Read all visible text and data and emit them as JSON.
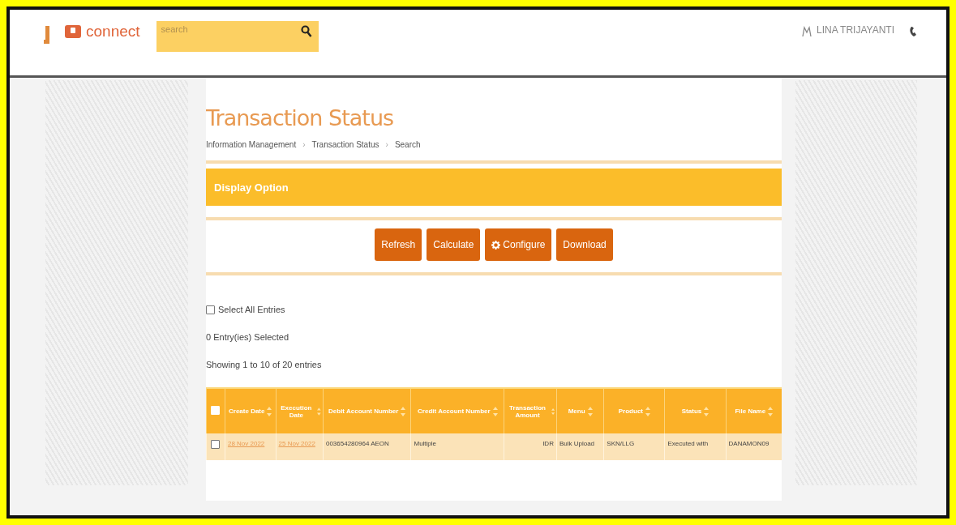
{
  "header": {
    "logo_text": "connect",
    "search": {
      "placeholder": "search"
    },
    "user": "LINA TRIJAYANTI"
  },
  "page": {
    "title": "Transaction Status",
    "breadcrumb_separator": "›",
    "breadcrumb": [
      "Information Management",
      "Transaction Status",
      "Search"
    ]
  },
  "display_option": {
    "title": "Display Option"
  },
  "buttons": [
    {
      "label": "Refresh",
      "kind": "plain"
    },
    {
      "label": "Calculate",
      "kind": "plain"
    },
    {
      "label": "Configure",
      "kind": "gear"
    },
    {
      "label": "Download",
      "kind": "plain"
    }
  ],
  "select_all": {
    "label": "Select All Entries",
    "checked": false
  },
  "selected_count": "0 Entry(ies) Selected",
  "showing": "Showing 1 to 10 of 20 entries",
  "table": {
    "header_checked": false,
    "columns": [
      {
        "label": "Create Date"
      },
      {
        "label": "Execution Date"
      },
      {
        "label": "Debit Account Number"
      },
      {
        "label": "Credit Account Number"
      },
      {
        "label": "Transaction Amount"
      },
      {
        "label": "Menu"
      },
      {
        "label": "Product"
      },
      {
        "label": "Status"
      },
      {
        "label": "File Name"
      }
    ],
    "rows": [
      {
        "checked": false,
        "cells": [
          {
            "text": "28 Nov 2022",
            "kind": "link"
          },
          {
            "text": "25 Nov 2022",
            "kind": "link"
          },
          {
            "text": "003654280964 AEON",
            "kind": "text"
          },
          {
            "text": "Multiple",
            "kind": "text"
          },
          {
            "text": "IDR",
            "kind": "amount"
          },
          {
            "text": "Bulk Upload",
            "kind": "text"
          },
          {
            "text": "SKN/LLG",
            "kind": "text"
          },
          {
            "text": "Executed with",
            "kind": "text"
          },
          {
            "text": "DANAMON09",
            "kind": "text"
          }
        ]
      }
    ]
  }
}
